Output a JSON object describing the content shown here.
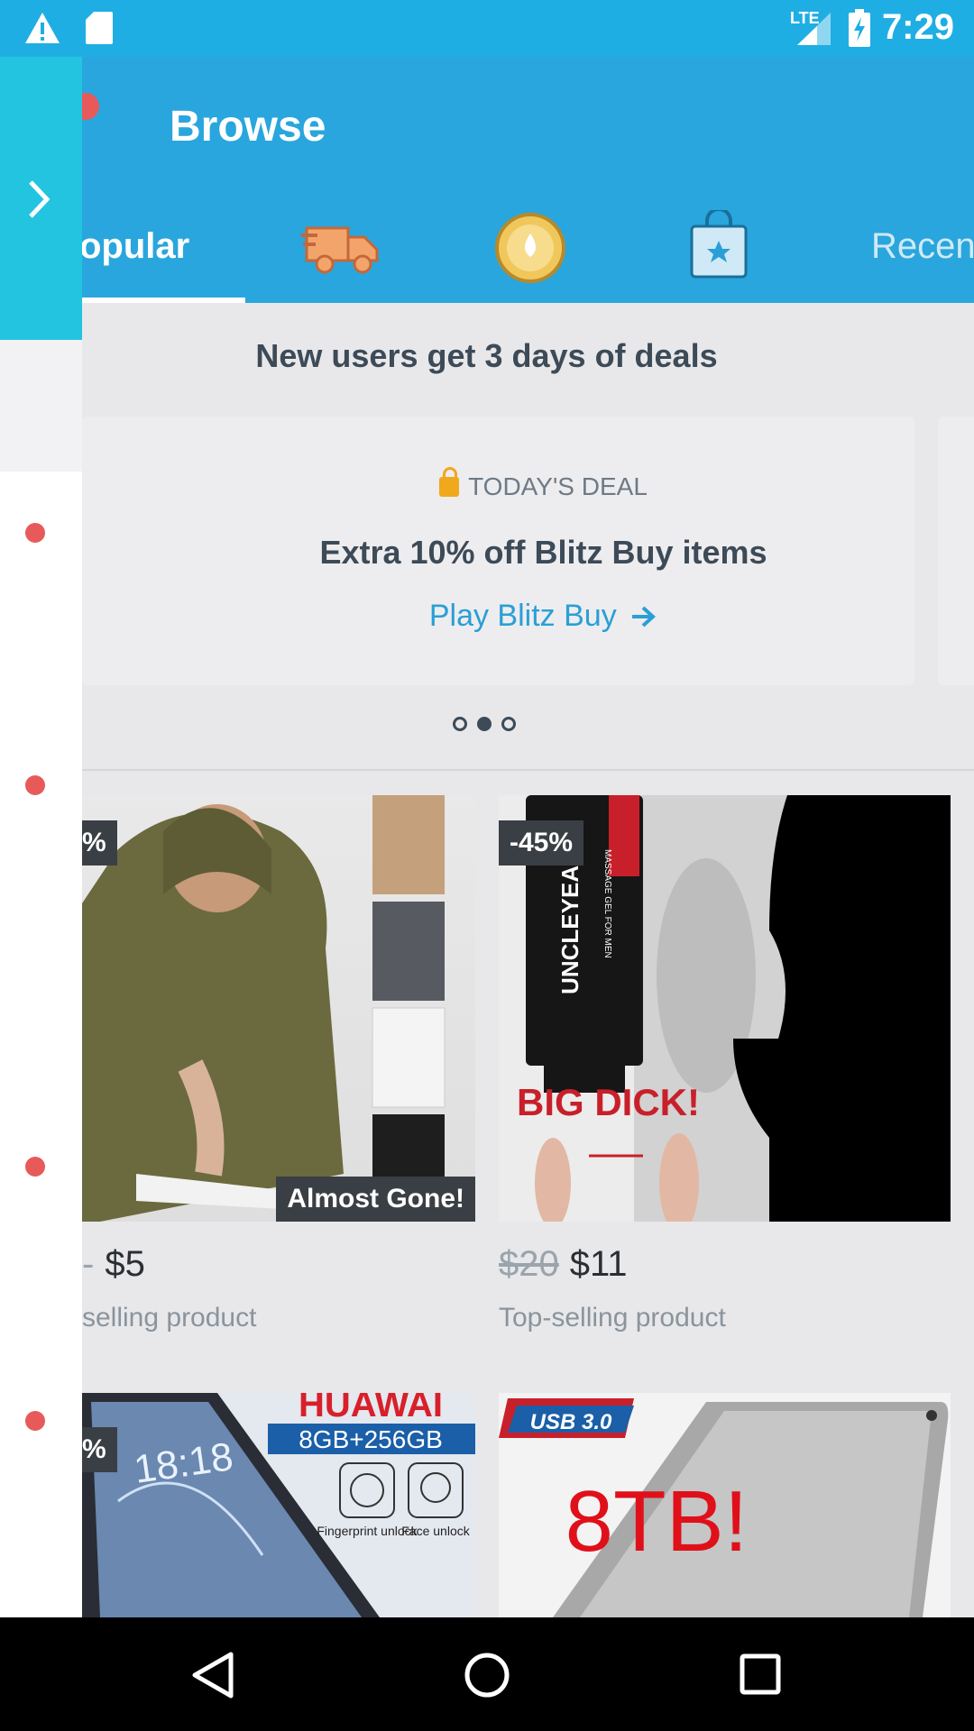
{
  "status_bar": {
    "time": "7:29",
    "network": "LTE"
  },
  "app_bar": {
    "title": "Browse"
  },
  "tabs": [
    {
      "label": "opular"
    },
    {
      "icon": "truck-icon"
    },
    {
      "icon": "coin-icon"
    },
    {
      "icon": "shopping-bag-star-icon"
    },
    {
      "label": "Recen"
    }
  ],
  "promo": {
    "heading": "New users get 3 days of deals",
    "deal_label": "TODAY'S DEAL",
    "deal_title": "Extra 10% off Blitz Buy items",
    "deal_link": "Play Blitz Buy",
    "pager_total": 3,
    "pager_active": 2
  },
  "products": [
    {
      "discount": "%",
      "badge": "Almost Gone!",
      "old_price": "",
      "price": "$5",
      "subtitle": "selling product",
      "price_prefix": "-"
    },
    {
      "discount": "-45%",
      "old_price": "$20",
      "price": "$11",
      "subtitle": "Top-selling product",
      "image_text": "BIG DICK!",
      "tube_text": "UNCLEYEAH",
      "tube_small": "MASSAGE GEL FOR MEN"
    },
    {
      "discount": "%",
      "image_brand": "HUAWAI",
      "image_spec": "8GB+256GB",
      "image_fingerprint": "Fingerprint unlock",
      "image_face": "Face unlock",
      "clock": "18:18"
    },
    {
      "image_badge": "USB 3.0",
      "image_text": "8TB!"
    }
  ],
  "colors": {
    "status_bar": "#1faee3",
    "app_bar": "#29a6dd",
    "drawer_handle": "#22c4e0",
    "accent_link": "#2a9fd6",
    "dot_red": "#e85a5a"
  }
}
